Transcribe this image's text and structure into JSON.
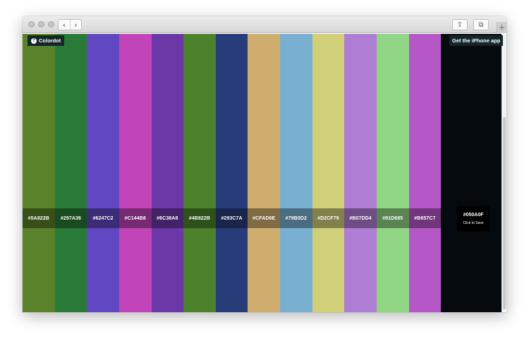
{
  "browser": {
    "back_glyph": "‹",
    "forward_glyph": "›",
    "share_glyph": "⇪",
    "tabs_glyph": "⧉",
    "new_tab_glyph": "+"
  },
  "app": {
    "brand": "Colordot",
    "logo_glyph": "?",
    "get_app": "Get the iPhone app"
  },
  "swatches": [
    {
      "hex": "#5A822B",
      "color": "#5A822B"
    },
    {
      "hex": "#297A36",
      "color": "#297A36"
    },
    {
      "hex": "#6247C2",
      "color": "#6247C2"
    },
    {
      "hex": "#C144B8",
      "color": "#C144B8"
    },
    {
      "hex": "#6C38A8",
      "color": "#6C38A8"
    },
    {
      "hex": "#4B822B",
      "color": "#4B822B"
    },
    {
      "hex": "#293C7A",
      "color": "#293C7A"
    },
    {
      "hex": "#CFAD6E",
      "color": "#CFAD6E"
    },
    {
      "hex": "#79B0D2",
      "color": "#79B0D2"
    },
    {
      "hex": "#D2CF79",
      "color": "#D2CF79"
    },
    {
      "hex": "#B07DD4",
      "color": "#B07DD4"
    },
    {
      "hex": "#91D685",
      "color": "#91D685"
    },
    {
      "hex": "#B657C7",
      "color": "#B657C7"
    }
  ],
  "selected": {
    "hex": "#050A0F",
    "color": "#050A0F",
    "action": "Click to Save"
  }
}
